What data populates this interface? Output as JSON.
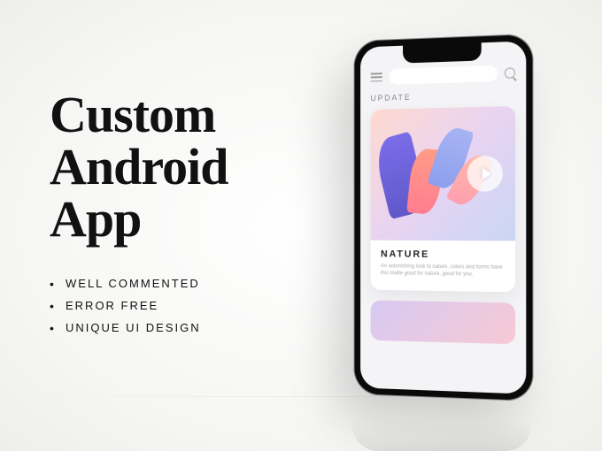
{
  "headline": {
    "line1": "Custom",
    "line2": "Android",
    "line3": "App"
  },
  "bullets": [
    "WELL COMMENTED",
    "ERROR FREE",
    "UNIQUE UI DESIGN"
  ],
  "phone": {
    "section_label": "UPDATE",
    "card": {
      "title": "NATURE",
      "desc": "An astonishing look to nature, colors and forms have this matte good for nature, good for you."
    }
  }
}
